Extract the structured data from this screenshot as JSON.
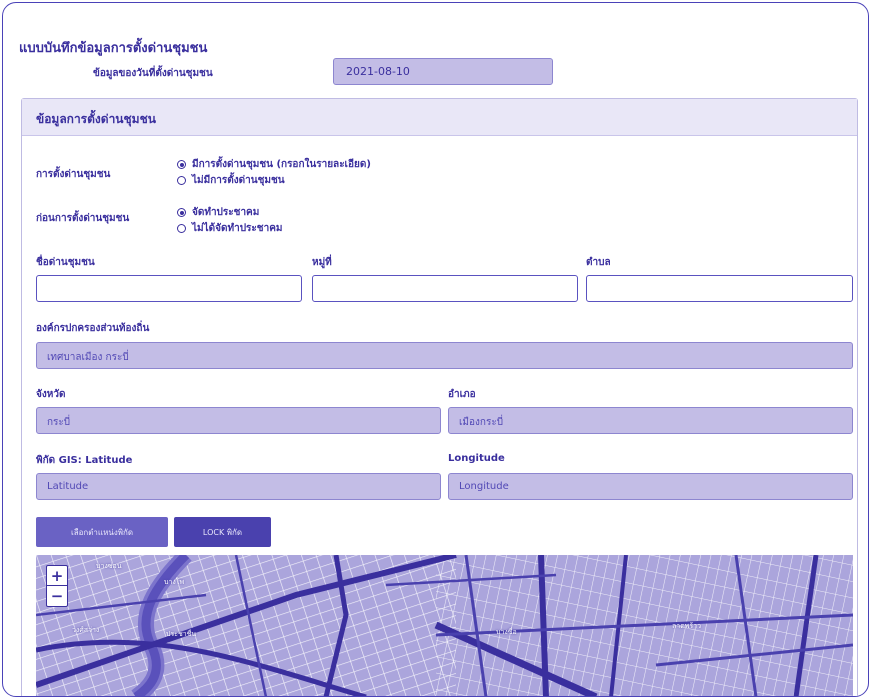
{
  "form": {
    "title": "แบบบันทึกข้อมูลการตั้งด่านชุมชน",
    "date_label": "ข้อมูลของวันที่ตั้งด่านชุมชน",
    "date_value": "2021-08-10"
  },
  "section": {
    "title": "ข้อมูลการตั้งด่านชุมชน",
    "checkpoint_label": "การตั้งด่านชุมชน",
    "checkpoint_options": [
      {
        "label": "มีการตั้งด่านชุมชน (กรอกในรายละเอียด)",
        "selected": true
      },
      {
        "label": "ไม่มีการตั้งด่านชุมชน",
        "selected": false
      }
    ],
    "before_label": "ก่อนการตั้งด่านชุมชน",
    "before_options": [
      {
        "label": "จัดทำประชาคม",
        "selected": true
      },
      {
        "label": "ไม่ได้จัดทำประชาคม",
        "selected": false
      }
    ],
    "name_label": "ชื่อด่านชุมชน",
    "village_label": "หมู่ที่",
    "subdistrict_label": "ตำบล",
    "org_label": "องค์กรปกครองส่วนท้องถิ่น",
    "org_value": "เทศบาลเมือง กระบี่",
    "province_label": "จังหวัด",
    "province_value": "กระบี่",
    "district_label": "อำเภอ",
    "district_value": "เมืองกระบี่",
    "lat_label": "พิกัด GIS: Latitude",
    "lat_placeholder": "Latitude",
    "lng_label": "Longitude",
    "lng_placeholder": "Longitude",
    "btn_select": "เลือกตำแหน่งพิกัด",
    "btn_lock": "LOCK พิกัด"
  },
  "map": {
    "zoom_in": "+",
    "zoom_out": "−",
    "labels": [
      "บางซ่อน",
      "บางโพ",
      "วงศ์สว่าง",
      "ประชาชื่น",
      "บางซื่อ",
      "ลาดพร้าว"
    ]
  },
  "colors": {
    "accent": "#3a2f9e",
    "readonly_bg": "#c3bde6",
    "button_bg": "#6a62c4",
    "button_dark": "#4a41ae"
  }
}
